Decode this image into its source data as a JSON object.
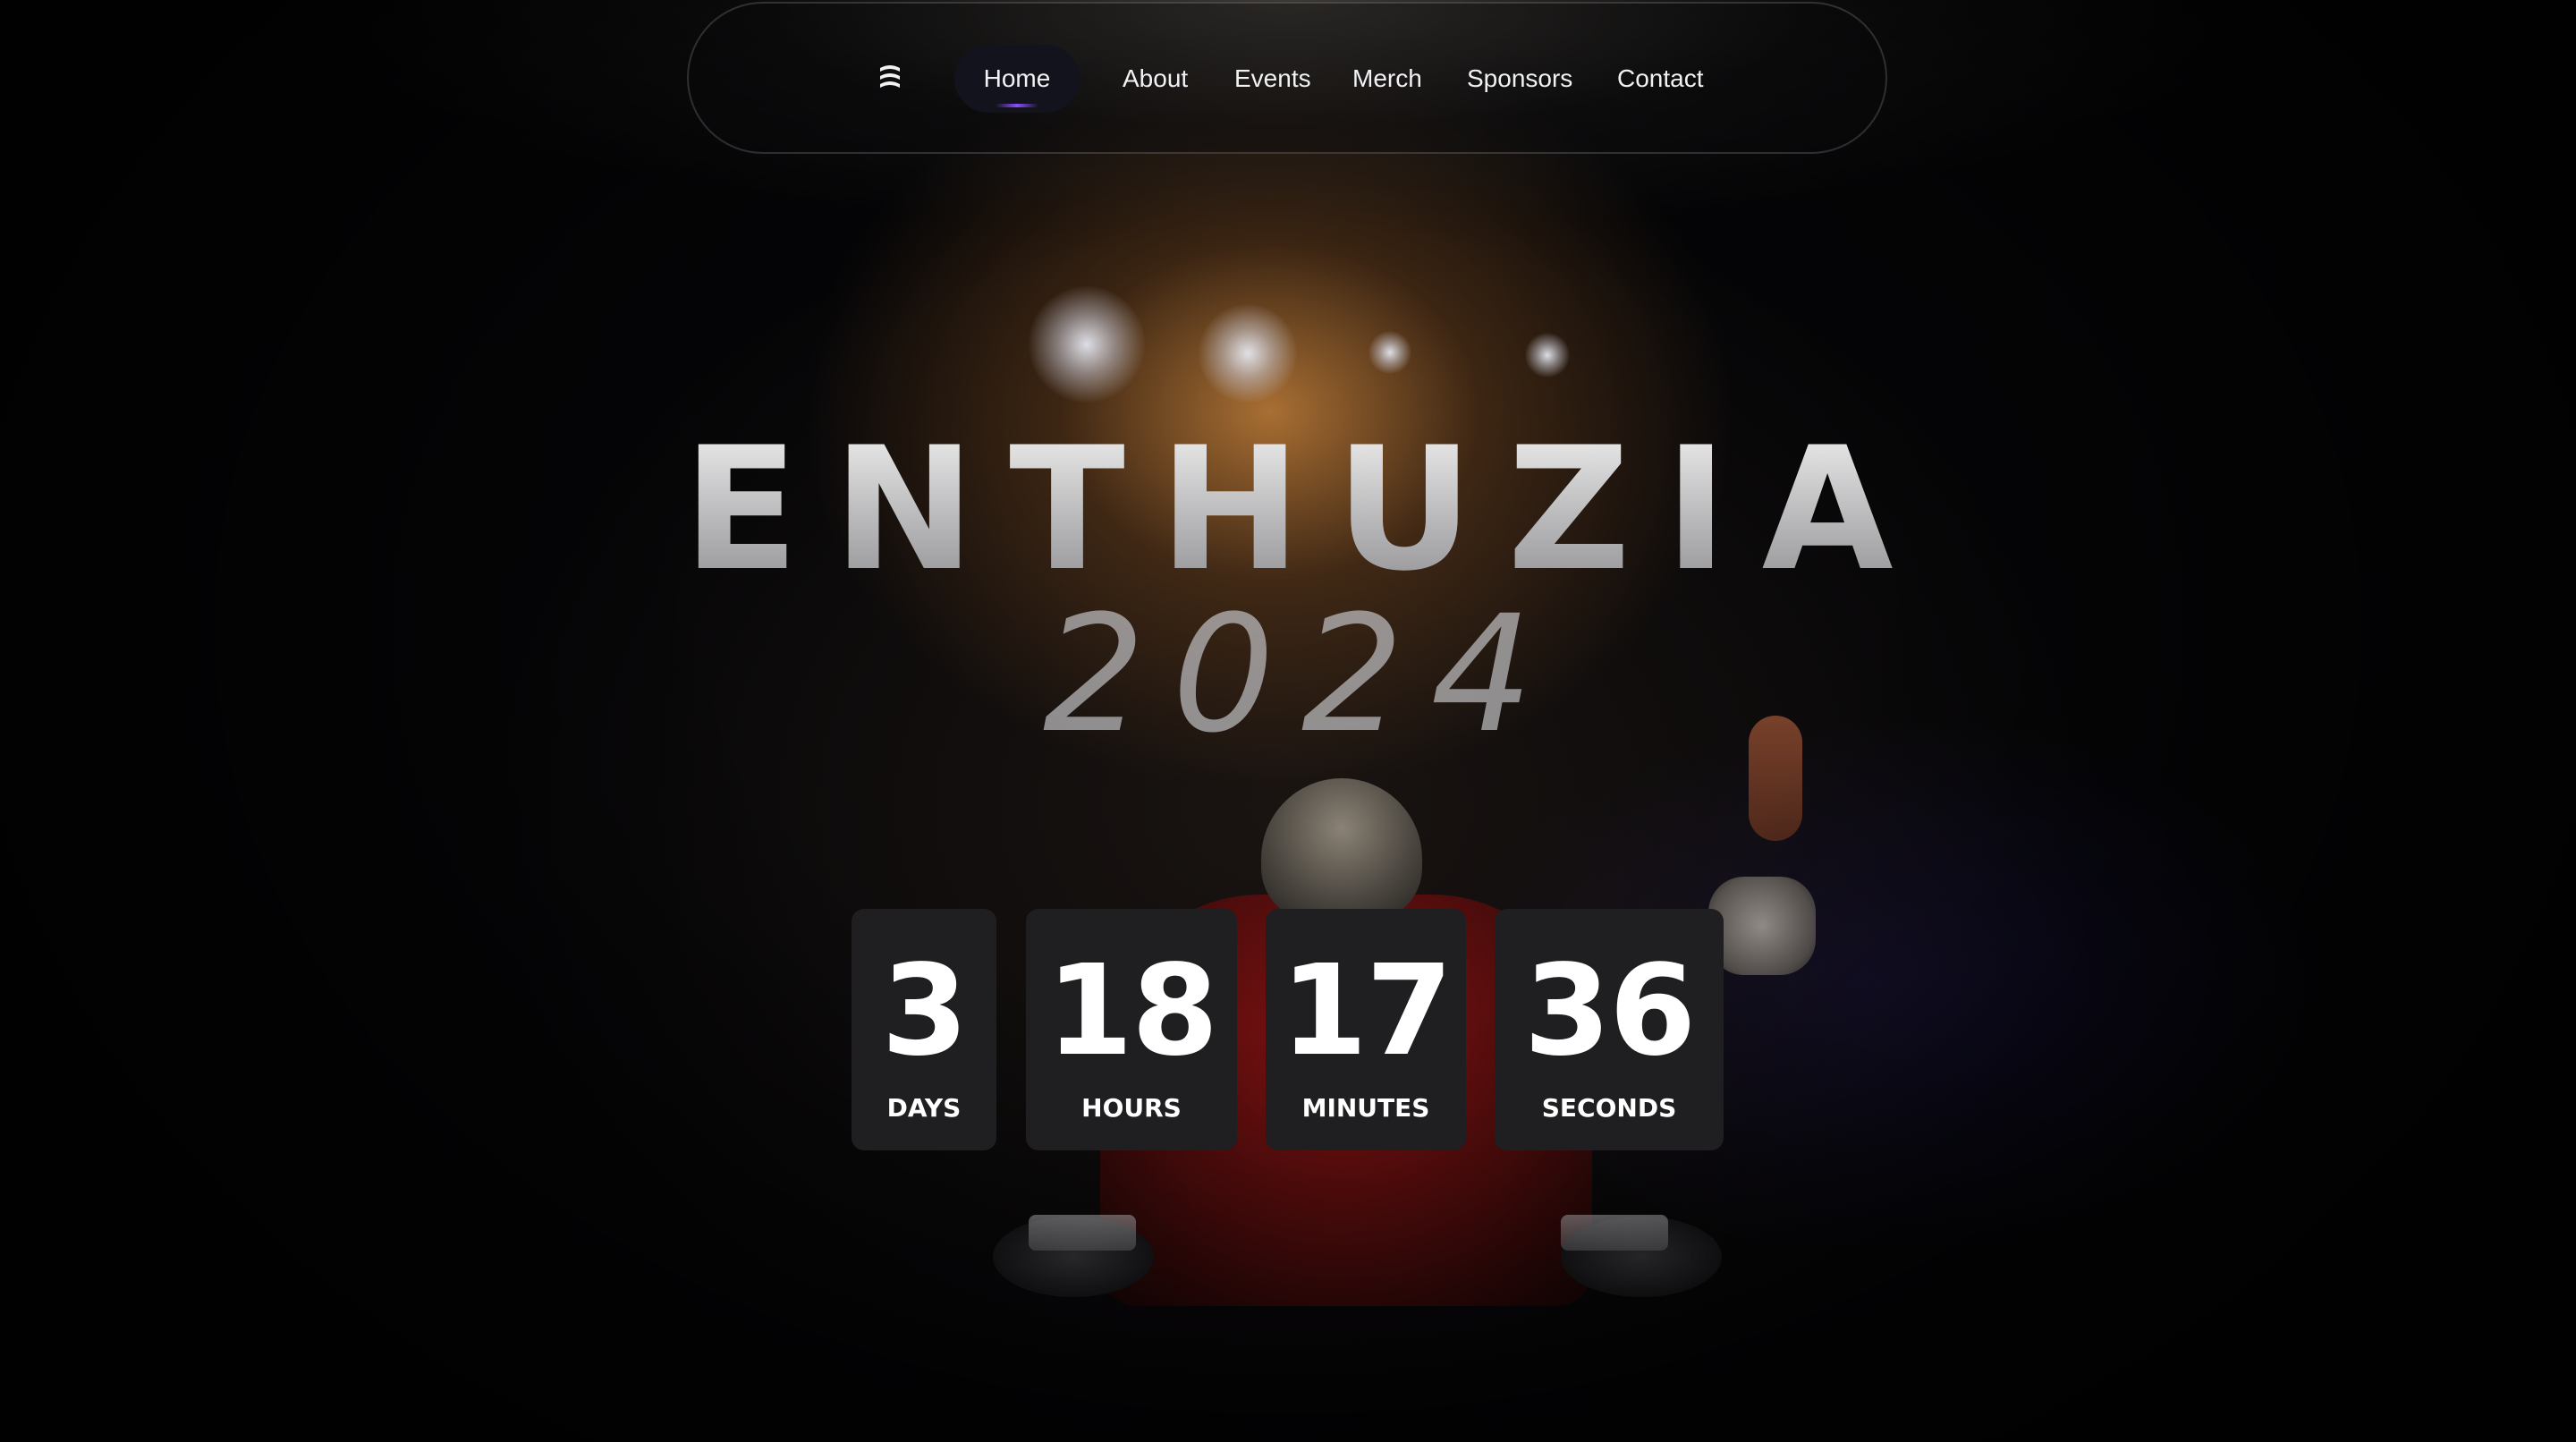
{
  "nav": {
    "logo_icon": "layers-logo-icon",
    "items": [
      {
        "label": "Home",
        "active": true
      },
      {
        "label": "About"
      },
      {
        "label": "Events"
      },
      {
        "label": "Merch"
      },
      {
        "label": "Sponsors"
      },
      {
        "label": "Contact"
      }
    ],
    "active_indicator_color": "#8a4dff"
  },
  "hero": {
    "title": "ENTHUZIA",
    "year": "2024"
  },
  "countdown": {
    "days": {
      "value": "3",
      "label": "DAYS"
    },
    "hours": {
      "value": "18",
      "label": "HOURS"
    },
    "minutes": {
      "value": "17",
      "label": "MINUTES"
    },
    "seconds": {
      "value": "36",
      "label": "SECONDS"
    }
  },
  "colors": {
    "background": "#050507",
    "card": "#1f1f22",
    "nav_active_pill": "#13131d",
    "text": "#f2f2f4"
  }
}
